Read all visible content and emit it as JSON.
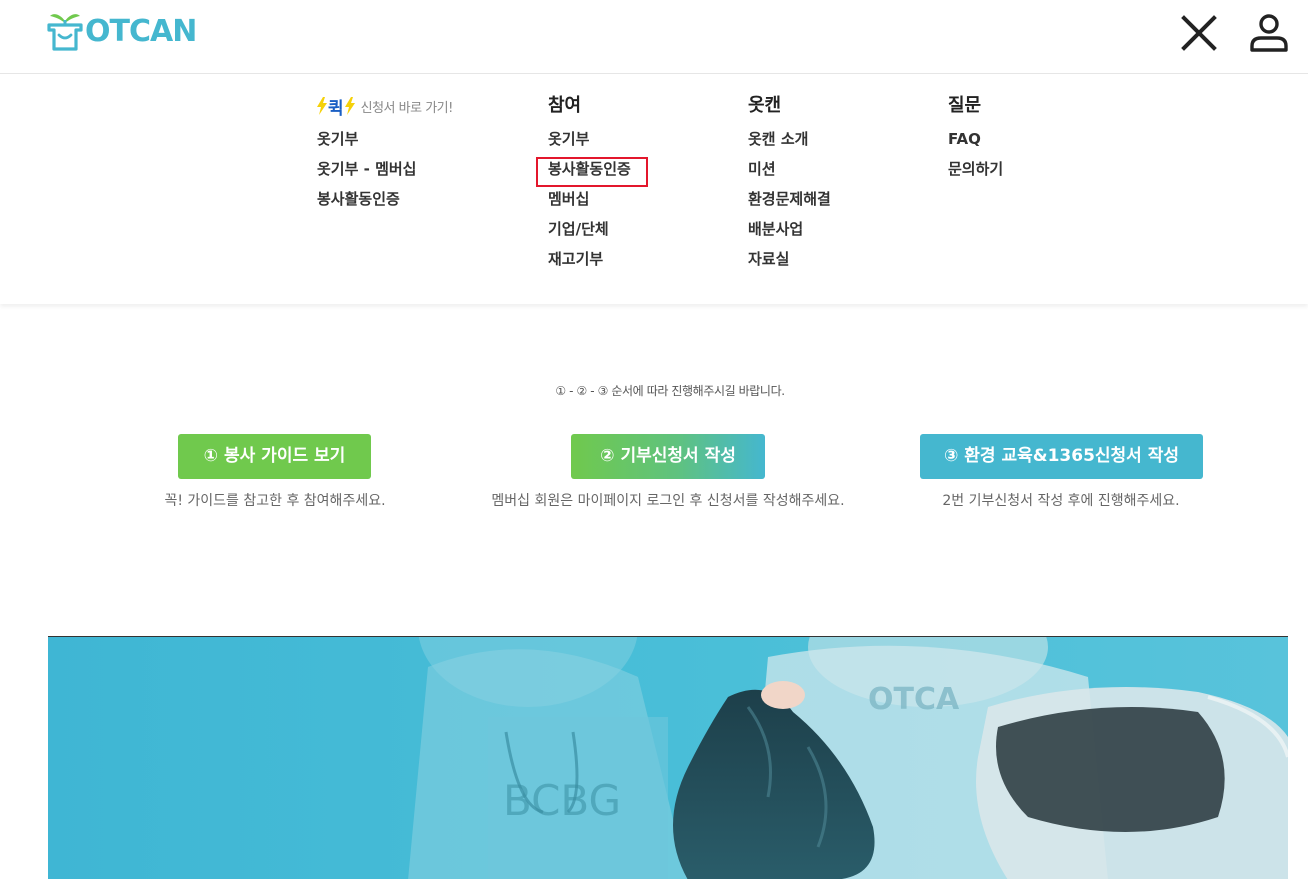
{
  "header": {
    "logo_text": "OTCAN",
    "close_icon": "close-icon",
    "user_icon": "user-icon"
  },
  "menu": {
    "quick": {
      "label": "퀵",
      "subtitle": "신청서 바로 가기!",
      "items": [
        "옷기부",
        "옷기부 - 멤버십",
        "봉사활동인증"
      ]
    },
    "participate": {
      "title": "참여",
      "items": [
        "옷기부",
        "봉사활동인증",
        "멤버십",
        "기업/단체",
        "재고기부"
      ]
    },
    "otcan": {
      "title": "옷캔",
      "items": [
        "옷캔 소개",
        "미션",
        "환경문제해결",
        "배분사업",
        "자료실"
      ]
    },
    "questions": {
      "title": "질문",
      "items": [
        "FAQ",
        "문의하기"
      ]
    }
  },
  "steps": {
    "note": "① - ② - ③ 순서에 따라 진행해주시길 바랍니다.",
    "step1": {
      "label": "① 봉사 가이드 보기",
      "desc": "꼭! 가이드를 참고한 후 참여해주세요."
    },
    "step2": {
      "label": "② 기부신청서 작성",
      "desc": "멤버십 회원은 마이페이지 로그인 후 신청서를 작성해주세요."
    },
    "step3": {
      "label": "③ 환경 교육&1365신청서 작성",
      "desc": "2번 기부신청서 작성 후에 진행해주세요."
    }
  },
  "banner": {
    "shirt_text_1": "OTCA",
    "shirt_text_2": "BCBG"
  },
  "colors": {
    "brand": "#45b7cf",
    "green": "#70c94d",
    "highlight": "#e3172c"
  }
}
